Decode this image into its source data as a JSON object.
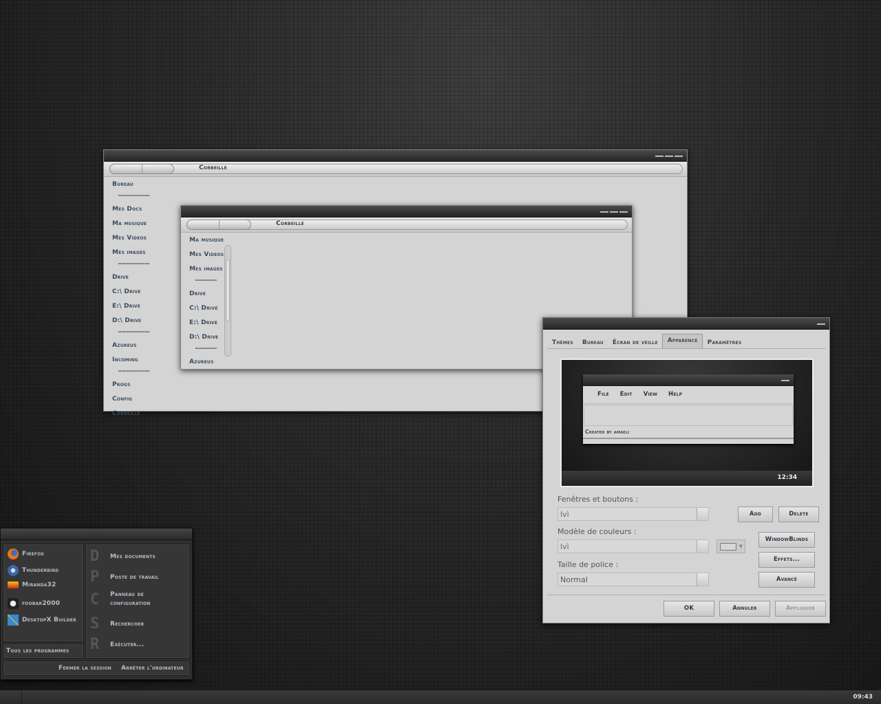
{
  "explorer1": {
    "title": "Corbeille",
    "sidebar": [
      "Bureau",
      "Mes Docs",
      "Ma musique",
      "Mes Videos",
      "Mes images",
      "Drive",
      "C:\\ Drive",
      "E:\\ Drive",
      "D:\\ Drive",
      "Azureus",
      "Incoming",
      "Progs",
      "Config",
      "Corbeille"
    ],
    "separator": "..................."
  },
  "explorer2": {
    "title": "Corbeille",
    "sidebar": [
      "Ma musique",
      "Mes Videos",
      "Mes images",
      "Drive",
      "C:\\ Drive",
      "E:\\ Drive",
      "D:\\ Drive",
      "Azureus"
    ]
  },
  "dialog": {
    "tabs": [
      "Thèmes",
      "Bureau",
      "Écran de veille",
      "Apparence",
      "Paramètres"
    ],
    "active_tab": "Apparence",
    "preview": {
      "menu": [
        "File",
        "Edit",
        "View",
        "Help"
      ],
      "status": "Created by amaeli",
      "clock": "12:34"
    },
    "windows_label": "Fenêtres et boutons :",
    "windows_value": "lvì",
    "color_label": "Modèle de couleurs :",
    "color_value": "lvì",
    "font_label": "Taille de police :",
    "font_value": "Normal",
    "buttons": {
      "add": "Add",
      "delete": "Delete",
      "windowblinds": "WindowBlinds",
      "effects": "Effets...",
      "advanced": "Avancé",
      "ok": "OK",
      "cancel": "Annuler",
      "apply": "Appliquer"
    }
  },
  "start_menu": {
    "programs": [
      "Firefox",
      "Thunderbird",
      "Miranda32",
      "foobar2000",
      "DesktopX Builder"
    ],
    "all_programs": "Tous les programmes",
    "places": [
      {
        "glyph": "D",
        "label": "Mes documents"
      },
      {
        "glyph": "P",
        "label": "Poste de travail"
      },
      {
        "glyph": "C",
        "label": "Panneau de configuration"
      },
      {
        "glyph": "S",
        "label": "Rechercher"
      },
      {
        "glyph": "R",
        "label": "Exécuter..."
      }
    ],
    "logoff": "Fermer la session",
    "shutdown": "Arrêter l'ordinateur"
  },
  "taskbar": {
    "clock": "09:43"
  }
}
